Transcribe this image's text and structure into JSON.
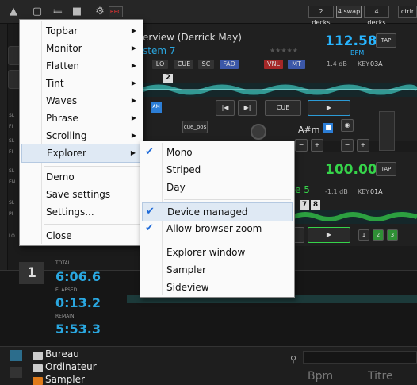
{
  "topbar": {
    "rec_label": "REC",
    "deck_buttons": [
      "2 decks",
      "4 swap",
      "4 decks",
      "ctrlr"
    ]
  },
  "deck_top": {
    "title": "erview (Derrick May)",
    "subtitle": "stem 7",
    "bpm": "112.58",
    "bpm_label": "BPM",
    "tap": "TAP",
    "gain": "1.4 dB",
    "key_label": "KEY",
    "key": "03A",
    "fx_tags": [
      "LO",
      "CUE",
      "SC",
      "FAD",
      "VNL",
      "MT"
    ],
    "marker": "2",
    "am": "AM",
    "cue": "CUE",
    "key_note": "A#m",
    "pad_label": "cue_pos"
  },
  "deck_bottom": {
    "bpm": "100.00",
    "tap": "TAP",
    "gain": "-1.1 dB",
    "key_label": "KEY",
    "key": "01A",
    "sub_frag": "e 5",
    "markers": [
      "7",
      "8"
    ],
    "pads": [
      "1",
      "2",
      "3"
    ]
  },
  "left_labels": [
    "SL",
    "FI",
    "SL",
    "FI",
    "SL",
    "EN",
    "SL",
    "PI",
    "LO"
  ],
  "timer": {
    "deck_number": "1",
    "total_label": "TOTAL",
    "total": "6:06.6",
    "elapsed_label": "ELAPSED",
    "elapsed": "0:13.2",
    "remain_label": "REMAIN",
    "remain": "5:53.3"
  },
  "browser": {
    "items": [
      "Bureau",
      "Ordinateur",
      "Sampler"
    ],
    "columns": [
      "Bpm",
      "Titre"
    ]
  },
  "main_menu": {
    "items": [
      {
        "label": "Topbar",
        "submenu": true
      },
      {
        "label": "Monitor",
        "submenu": true
      },
      {
        "label": "Flatten",
        "submenu": true
      },
      {
        "label": "Tint",
        "submenu": true
      },
      {
        "label": "Waves",
        "submenu": true
      },
      {
        "label": "Phrase",
        "submenu": true
      },
      {
        "label": "Scrolling",
        "submenu": true
      },
      {
        "label": "Explorer",
        "submenu": true,
        "highlighted": true
      },
      {
        "label": "Demo",
        "submenu": false
      },
      {
        "label": "Save settings",
        "submenu": false
      },
      {
        "label": "Settings...",
        "submenu": false
      },
      {
        "label": "Close",
        "submenu": false
      }
    ]
  },
  "explorer_menu": {
    "items": [
      {
        "label": "Mono",
        "checked": true
      },
      {
        "label": "Striped",
        "checked": false
      },
      {
        "label": "Day",
        "checked": false
      },
      {
        "label": "Device managed",
        "checked": true,
        "highlighted": true
      },
      {
        "label": "Allow browser zoom",
        "checked": true
      },
      {
        "label": "Explorer window",
        "checked": false
      },
      {
        "label": "Sampler",
        "checked": false
      },
      {
        "label": "Sideview",
        "checked": false
      }
    ]
  },
  "colors": {
    "accent_blue": "#2aa7e0",
    "accent_green": "#36d44a",
    "rec_red": "#e33333"
  }
}
